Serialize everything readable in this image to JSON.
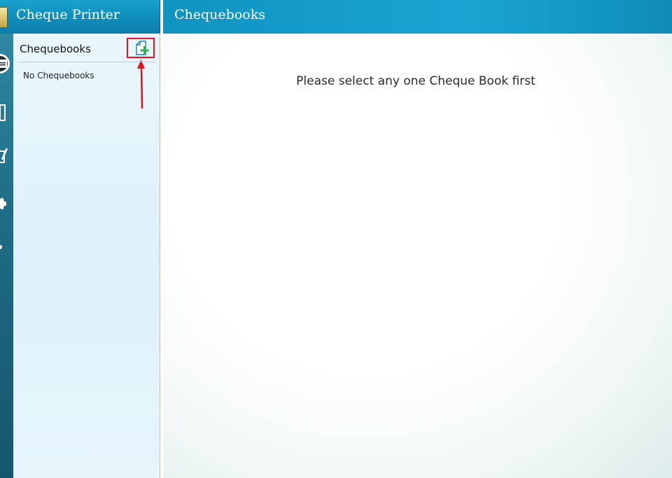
{
  "app": {
    "title": "Cheque Printer"
  },
  "sidebar": {
    "title": "Chequebooks",
    "empty_text": "No Chequebooks",
    "add_icon": "add-document-icon"
  },
  "main": {
    "title": "Chequebooks",
    "message": "Please select any one Cheque Book first"
  },
  "rail": {
    "icons": [
      "chequebook-icon",
      "document-icon",
      "edit-icon",
      "settings-icon",
      "help-icon"
    ]
  },
  "colors": {
    "header": "#1aa2cf",
    "highlight": "#e0151b",
    "add_plus": "#2db34a"
  }
}
